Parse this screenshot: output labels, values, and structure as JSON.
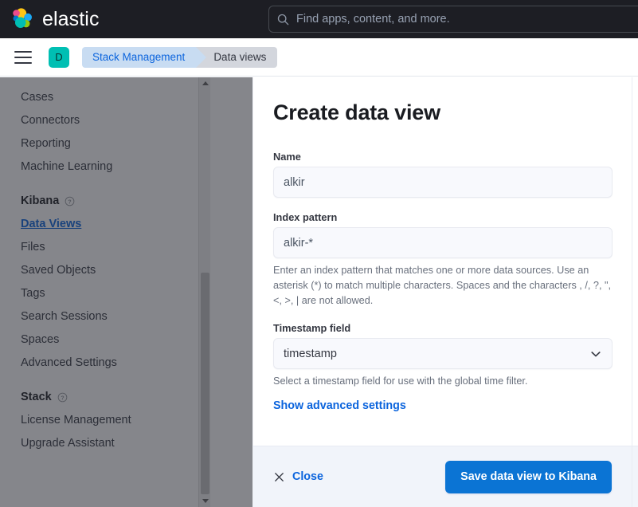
{
  "header": {
    "brand_name": "elastic",
    "search_placeholder": "Find apps, content, and more.",
    "search_icon": "search-icon",
    "logo_icon": "elastic-logo-icon"
  },
  "breadcrumb_bar": {
    "menu_icon": "hamburger-menu-icon",
    "space_avatar_letter": "D",
    "crumbs": [
      {
        "label": "Stack Management",
        "active": true
      },
      {
        "label": "Data views",
        "active": false
      }
    ]
  },
  "sidebar": {
    "items": [
      {
        "label": "Cases",
        "type": "link"
      },
      {
        "label": "Connectors",
        "type": "link"
      },
      {
        "label": "Reporting",
        "type": "link"
      },
      {
        "label": "Machine Learning",
        "type": "link"
      }
    ],
    "groups": [
      {
        "title": "Kibana",
        "help_icon": "question-circle-icon",
        "items": [
          {
            "label": "Data Views",
            "selected": true
          },
          {
            "label": "Files",
            "selected": false
          },
          {
            "label": "Saved Objects",
            "selected": false
          },
          {
            "label": "Tags",
            "selected": false
          },
          {
            "label": "Search Sessions",
            "selected": false
          },
          {
            "label": "Spaces",
            "selected": false
          },
          {
            "label": "Advanced Settings",
            "selected": false
          }
        ]
      },
      {
        "title": "Stack",
        "help_icon": "question-circle-icon",
        "items": [
          {
            "label": "License Management",
            "selected": false
          },
          {
            "label": "Upgrade Assistant",
            "selected": false
          }
        ]
      }
    ],
    "scrollbar": {
      "up_arrow_icon": "scroll-up-arrow-icon",
      "down_arrow_icon": "scroll-down-arrow-icon"
    }
  },
  "flyout": {
    "title": "Create data view",
    "fields": {
      "name": {
        "label": "Name",
        "value": "alkir",
        "placeholder": ""
      },
      "index_pattern": {
        "label": "Index pattern",
        "value": "alkir-*",
        "placeholder": "",
        "help": "Enter an index pattern that matches one or more data sources. Use an asterisk (*) to match multiple characters. Spaces and the characters , /, ?, \", <, >, | are not allowed."
      },
      "timestamp_field": {
        "label": "Timestamp field",
        "value": "timestamp",
        "help": "Select a timestamp field for use with the global time filter.",
        "chevron_icon": "chevron-down-icon"
      }
    },
    "advanced_link": "Show advanced settings",
    "footer": {
      "close_label": "Close",
      "close_icon": "close-x-icon",
      "save_label": "Save data view to Kibana"
    }
  },
  "colors": {
    "header_bg": "#1d1e24",
    "accent_blue": "#0b64dd",
    "primary_button": "#0b74d4",
    "avatar_teal": "#00bfb3",
    "crumb_active_bg": "#c8dcf2",
    "crumb_inactive_bg": "#d3d6dd",
    "footer_bg": "#f1f4fa"
  }
}
